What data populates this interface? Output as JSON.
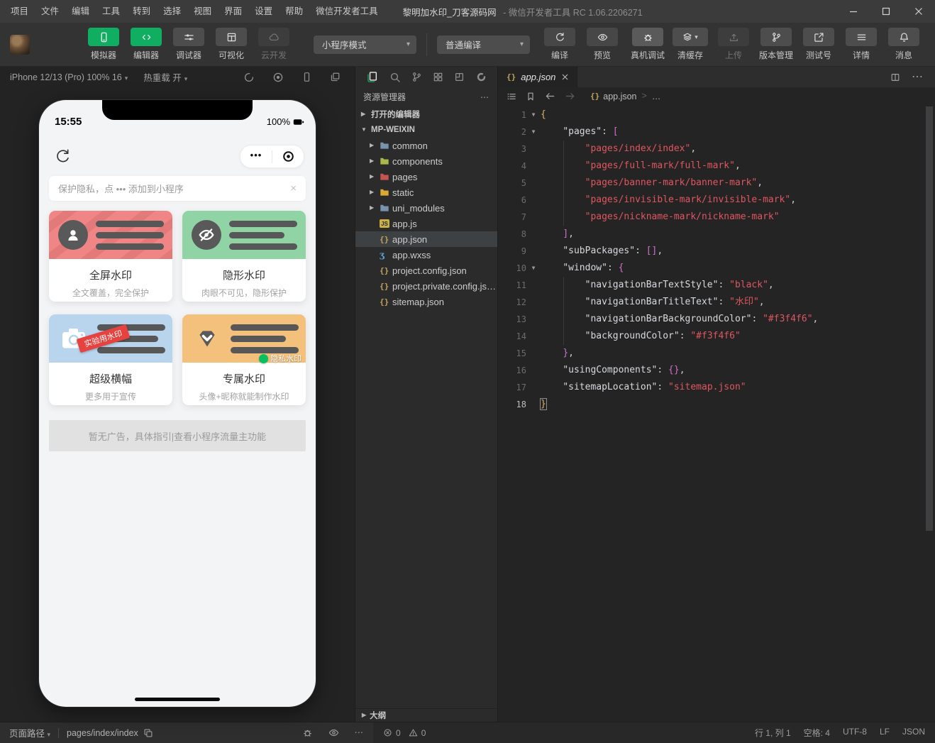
{
  "window": {
    "menus": [
      "项目",
      "文件",
      "编辑",
      "工具",
      "转到",
      "选择",
      "视图",
      "界面",
      "设置",
      "帮助",
      "微信开发者工具"
    ],
    "title": "黎明加水印_刀客源码网",
    "title_suffix": "- 微信开发者工具 RC 1.06.2206271"
  },
  "icons": {
    "caret": "▾",
    "chev_right": "▶",
    "chev_down": "▼",
    "more_h": "⋯",
    "ellipsis": "…",
    "gt": ">",
    "dots": "•••",
    "close_x": "×",
    "js_badge": "JS",
    "braces": "{}",
    "wxss_badge": "ʒ"
  },
  "toolbar": {
    "left_buttons": [
      {
        "label": "模拟器"
      },
      {
        "label": "编辑器"
      },
      {
        "label": "调试器"
      },
      {
        "label": "可视化"
      },
      {
        "label": "云开发"
      }
    ],
    "mode_select": "小程序模式",
    "compile_select": "普通编译",
    "compile_label": "编译",
    "preview_label": "预览",
    "device_debug_label": "真机调试",
    "clear_cache_label": "清缓存",
    "upload_label": "上传",
    "version_label": "版本管理",
    "test_label": "测试号",
    "detail_label": "详情",
    "message_label": "消息"
  },
  "simulator": {
    "device": "iPhone 12/13 (Pro) 100% 16",
    "hot_reload": "热重载 开",
    "phone": {
      "time": "15:55",
      "battery": "100%",
      "privacy_notice": "保护隐私，点 ••• 添加到小程序",
      "ad_text": "暂无广告，具体指引|查看小程序流量主功能",
      "cards": [
        {
          "title": "全屏水印",
          "subtitle": "全文覆盖，完全保护",
          "color": "#ef8585",
          "icon": "person",
          "circle": true,
          "watermark": true,
          "bars": [
            96,
            96,
            96
          ]
        },
        {
          "title": "隐形水印",
          "subtitle": "肉眼不可见，隐形保护",
          "color": "#90d3a4",
          "icon": "eyeoff",
          "circle": true,
          "bars": [
            96,
            78,
            96
          ]
        },
        {
          "title": "超级横幅",
          "subtitle": "更多用于宣传",
          "color": "#b9d5ee",
          "icon": "camera",
          "circle": false,
          "ribbon": "实验用水印",
          "bars": [
            96,
            86,
            96
          ]
        },
        {
          "title": "专属水印",
          "subtitle": "头像+昵称就能制作水印",
          "color": "#f4c17c",
          "icon": "gem",
          "circle": false,
          "badge": "隐私水印",
          "bars": [
            96,
            78,
            96
          ]
        }
      ]
    }
  },
  "explorer": {
    "title": "资源管理器",
    "outline_label": "大纲",
    "tree": [
      {
        "label": "打开的编辑器",
        "type": "section",
        "arrow": "right"
      },
      {
        "label": "MP-WEIXIN",
        "type": "section",
        "arrow": "down"
      },
      {
        "label": "common",
        "type": "folder",
        "color": "#7a93ad",
        "arrow": "right"
      },
      {
        "label": "components",
        "type": "folder",
        "color": "#aab74a",
        "arrow": "right"
      },
      {
        "label": "pages",
        "type": "folder",
        "color": "#c75450",
        "arrow": "right"
      },
      {
        "label": "static",
        "type": "folder",
        "color": "#d9a935",
        "arrow": "right"
      },
      {
        "label": "uni_modules",
        "type": "folder",
        "color": "#7a93ad",
        "arrow": "right"
      },
      {
        "label": "app.js",
        "type": "js"
      },
      {
        "label": "app.json",
        "type": "json",
        "selected": true
      },
      {
        "label": "app.wxss",
        "type": "wxss"
      },
      {
        "label": "project.config.json",
        "type": "json"
      },
      {
        "label": "project.private.config.js…",
        "type": "json"
      },
      {
        "label": "sitemap.json",
        "type": "json"
      }
    ]
  },
  "editor": {
    "tab": "app.json",
    "breadcrumb_file": "app.json",
    "breadcrumb_more": "…",
    "code_lines": [
      {
        "n": "1",
        "fold": true,
        "t": [
          [
            "{",
            "b1"
          ]
        ]
      },
      {
        "n": "2",
        "fold": true,
        "t": [
          [
            "    ",
            "p"
          ],
          [
            "\"pages\"",
            "k"
          ],
          [
            ": ",
            "p"
          ],
          [
            "[",
            "b2"
          ]
        ]
      },
      {
        "n": "3",
        "guide": true,
        "t": [
          [
            "        ",
            "p"
          ],
          [
            "\"pages/index/index\"",
            "s"
          ],
          [
            ",",
            "p"
          ]
        ]
      },
      {
        "n": "4",
        "guide": true,
        "t": [
          [
            "        ",
            "p"
          ],
          [
            "\"pages/full-mark/full-mark\"",
            "s"
          ],
          [
            ",",
            "p"
          ]
        ]
      },
      {
        "n": "5",
        "guide": true,
        "t": [
          [
            "        ",
            "p"
          ],
          [
            "\"pages/banner-mark/banner-mark\"",
            "s"
          ],
          [
            ",",
            "p"
          ]
        ]
      },
      {
        "n": "6",
        "guide": true,
        "t": [
          [
            "        ",
            "p"
          ],
          [
            "\"pages/invisible-mark/invisible-mark\"",
            "s"
          ],
          [
            ",",
            "p"
          ]
        ]
      },
      {
        "n": "7",
        "guide": true,
        "t": [
          [
            "        ",
            "p"
          ],
          [
            "\"pages/nickname-mark/nickname-mark\"",
            "s"
          ]
        ]
      },
      {
        "n": "8",
        "t": [
          [
            "    ",
            "p"
          ],
          [
            "]",
            "b2"
          ],
          [
            ",",
            "p"
          ]
        ]
      },
      {
        "n": "9",
        "t": [
          [
            "    ",
            "p"
          ],
          [
            "\"subPackages\"",
            "k"
          ],
          [
            ": ",
            "p"
          ],
          [
            "[]",
            "b2"
          ],
          [
            ",",
            "p"
          ]
        ]
      },
      {
        "n": "10",
        "fold": true,
        "t": [
          [
            "    ",
            "p"
          ],
          [
            "\"window\"",
            "k"
          ],
          [
            ": ",
            "p"
          ],
          [
            "{",
            "b2"
          ]
        ]
      },
      {
        "n": "11",
        "guide": true,
        "t": [
          [
            "        ",
            "p"
          ],
          [
            "\"navigationBarTextStyle\"",
            "k"
          ],
          [
            ": ",
            "p"
          ],
          [
            "\"black\"",
            "s"
          ],
          [
            ",",
            "p"
          ]
        ]
      },
      {
        "n": "12",
        "guide": true,
        "t": [
          [
            "        ",
            "p"
          ],
          [
            "\"navigationBarTitleText\"",
            "k"
          ],
          [
            ": ",
            "p"
          ],
          [
            "\"水印\"",
            "s"
          ],
          [
            ",",
            "p"
          ]
        ]
      },
      {
        "n": "13",
        "guide": true,
        "t": [
          [
            "        ",
            "p"
          ],
          [
            "\"navigationBarBackgroundColor\"",
            "k"
          ],
          [
            ": ",
            "p"
          ],
          [
            "\"#f3f4f6\"",
            "s"
          ],
          [
            ",",
            "p"
          ]
        ]
      },
      {
        "n": "14",
        "guide": true,
        "t": [
          [
            "        ",
            "p"
          ],
          [
            "\"backgroundColor\"",
            "k"
          ],
          [
            ": ",
            "p"
          ],
          [
            "\"#f3f4f6\"",
            "s"
          ]
        ]
      },
      {
        "n": "15",
        "t": [
          [
            "    ",
            "p"
          ],
          [
            "}",
            "b2"
          ],
          [
            ",",
            "p"
          ]
        ]
      },
      {
        "n": "16",
        "t": [
          [
            "    ",
            "p"
          ],
          [
            "\"usingComponents\"",
            "k"
          ],
          [
            ": ",
            "p"
          ],
          [
            "{}",
            "b2"
          ],
          [
            ",",
            "p"
          ]
        ]
      },
      {
        "n": "17",
        "t": [
          [
            "    ",
            "p"
          ],
          [
            "\"sitemapLocation\"",
            "k"
          ],
          [
            ": ",
            "p"
          ],
          [
            "\"sitemap.json\"",
            "s"
          ]
        ]
      },
      {
        "n": "18",
        "active": true,
        "t": [
          [
            "}",
            "cur"
          ]
        ]
      }
    ]
  },
  "statusbar": {
    "page_path_label": "页面路径",
    "page_path": "pages/index/index",
    "errors": "0",
    "warnings": "0",
    "right_items": [
      "行 1, 列 1",
      "空格: 4",
      "UTF-8",
      "LF",
      "JSON"
    ]
  }
}
